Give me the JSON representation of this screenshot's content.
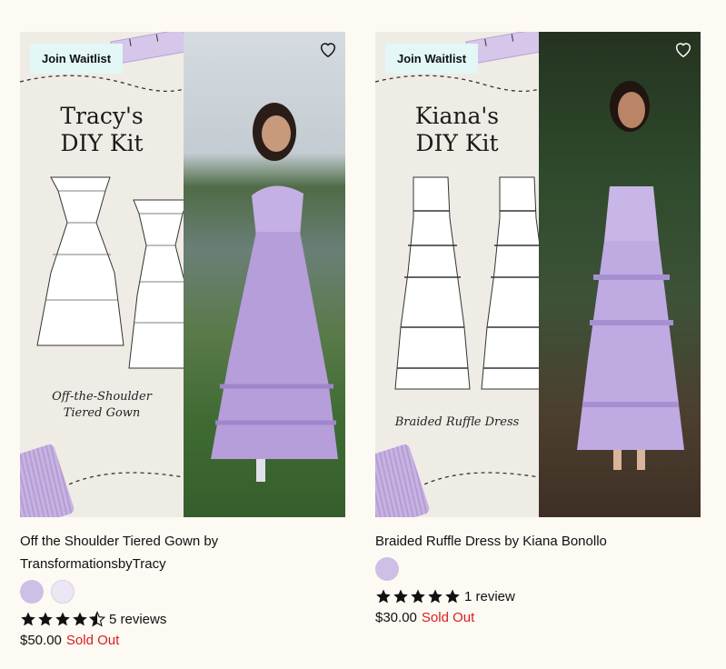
{
  "products": [
    {
      "badge": "Join Waitlist",
      "kit_title_line1": "Tracy's",
      "kit_title_line2": "DIY Kit",
      "kit_subtitle_line1": "Off-the-Shoulder",
      "kit_subtitle_line2": "Tiered Gown",
      "title_line1": "Off the Shoulder Tiered Gown by",
      "title_line2": "TransformationsbyTracy",
      "rating": 4.5,
      "reviews_text": "5 reviews",
      "price": "$50.00",
      "status": "Sold Out",
      "swatch_color": "#cdbfe6"
    },
    {
      "badge": "Join Waitlist",
      "kit_title_line1": "Kiana's",
      "kit_title_line2": "DIY Kit",
      "kit_subtitle_line1": "Braided Ruffle Dress",
      "title_line1": "Braided Ruffle Dress by Kiana Bonollo",
      "rating": 5,
      "reviews_text": "1 review",
      "price": "$30.00",
      "status": "Sold Out",
      "swatch_color": "#cdbfe6"
    }
  ],
  "colors": {
    "background": "#fdf9f3",
    "badge_bg": "#e2f7f6",
    "sold_out": "#d61f1f",
    "lavender": "#cdbfe6"
  }
}
